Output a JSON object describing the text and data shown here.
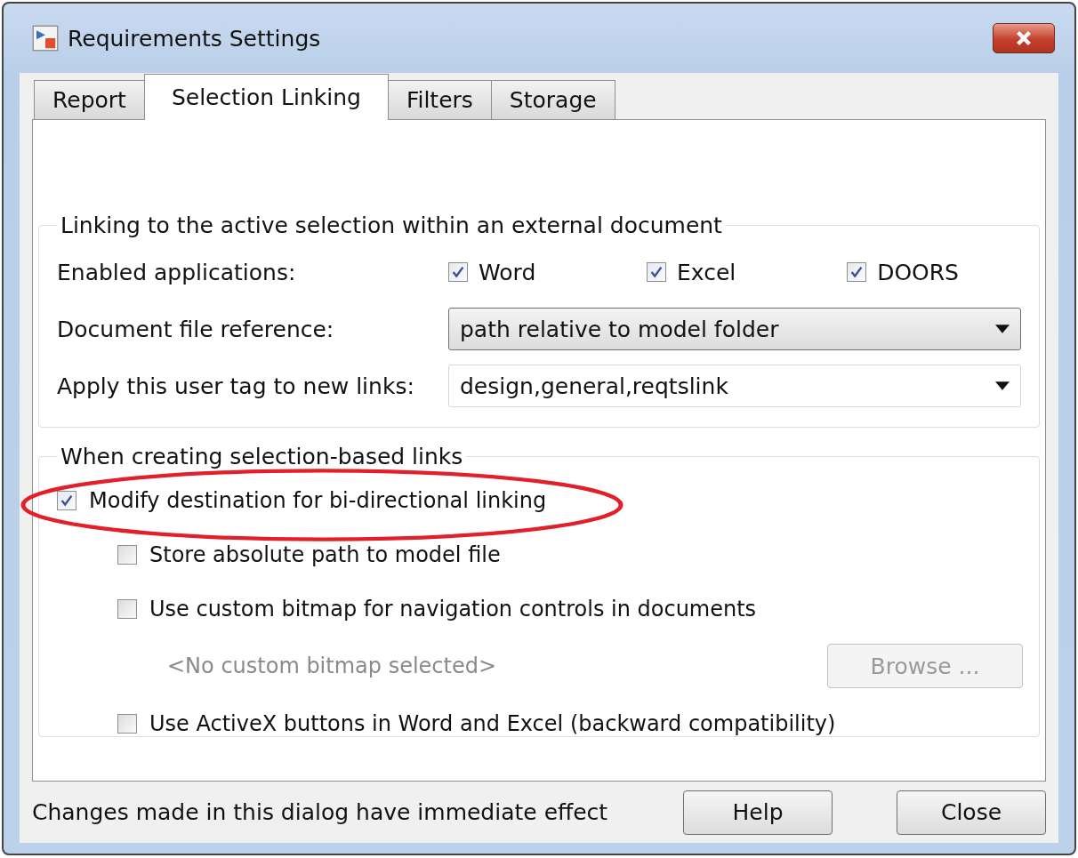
{
  "window": {
    "title": "Requirements Settings"
  },
  "tabs": [
    {
      "label": "Report",
      "selected": false
    },
    {
      "label": "Selection Linking",
      "selected": true
    },
    {
      "label": "Filters",
      "selected": false
    },
    {
      "label": "Storage",
      "selected": false
    }
  ],
  "linking_group": {
    "title": "Linking to the active selection within an external document",
    "enabled_label": "Enabled applications:",
    "applications": [
      {
        "label": "Word",
        "checked": true
      },
      {
        "label": "Excel",
        "checked": true
      },
      {
        "label": "DOORS",
        "checked": true
      }
    ],
    "fields": [
      {
        "kind": "select",
        "label": "Document file reference:",
        "value": "path relative to model folder"
      },
      {
        "kind": "combo",
        "label": "Apply this user tag to new links:",
        "value": "design,general,reqtslink"
      }
    ]
  },
  "creation_group": {
    "title": "When creating selection-based links",
    "options": [
      {
        "kind": "checkbox",
        "label": "Modify destination for bi-directional linking",
        "checked": true,
        "children": [
          {
            "kind": "checkbox",
            "label": "Store absolute path to model file",
            "checked": false
          },
          {
            "kind": "checkbox",
            "label": "Use custom bitmap for navigation controls in documents",
            "checked": false,
            "children": [
              {
                "kind": "file",
                "note": "<No custom bitmap selected>",
                "button": "Browse ...",
                "disabled": true
              }
            ]
          },
          {
            "kind": "checkbox",
            "label": "Use ActiveX buttons in Word and Excel (backward compatibility)",
            "checked": false
          }
        ]
      }
    ]
  },
  "status": "Changes made in this dialog have immediate effect",
  "buttons": [
    "Help",
    "Close"
  ]
}
